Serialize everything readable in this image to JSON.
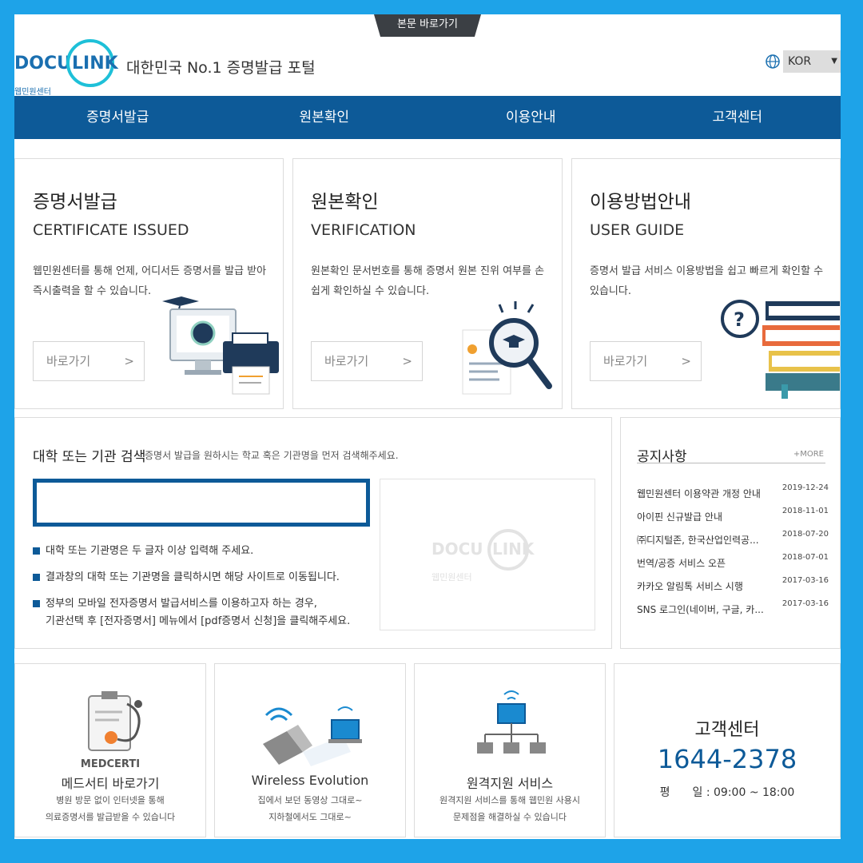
{
  "skip_link": "본문 바로가기",
  "header": {
    "logo_sub": "웹민원센터",
    "tagline": "대한민국 No.1 증명발급 포털",
    "language": "KOR"
  },
  "nav": [
    "증명서발급",
    "원본확인",
    "이용안내",
    "고객센터"
  ],
  "cards": [
    {
      "title": "증명서발급",
      "subtitle": "CERTIFICATE ISSUED",
      "desc": "웹민원센터를 통해 언제, 어디서든 증명서를 발급 받아 즉시출력을 할 수 있습니다.",
      "button": "바로가기",
      "arrow": ">"
    },
    {
      "title": "원본확인",
      "subtitle": "VERIFICATION",
      "desc": "원본확인 문서번호를 통해 증명서 원본 진위 여부를 손쉽게 확인하실 수 있습니다.",
      "button": "바로가기",
      "arrow": ">"
    },
    {
      "title": "이용방법안내",
      "subtitle": "USER GUIDE",
      "desc": "증명서 발급 서비스 이용방법을 쉽고 빠르게 확인할 수 있습니다.",
      "button": "바로가기",
      "arrow": ">"
    }
  ],
  "search": {
    "title": "대학 또는 기관 검색",
    "subtitle": "증명서 발급을 원하시는 학교 혹은 기관명을 먼저 검색해주세요.",
    "input_value": "",
    "bullets": [
      "대학 또는 기관명은 두 글자 이상 입력해 주세요.",
      "결과창의 대학 또는 기관명을 클릭하시면 해당 사이트로 이동됩니다.",
      "정부의 모바일 전자증명서 발급서비스를 이용하고자 하는 경우,\n기관선택 후 [전자증명서] 메뉴에서 [pdf증명서 신청]을 클릭해주세요."
    ],
    "watermark_sub": "웹민원센터"
  },
  "notice": {
    "title": "공지사항",
    "more": "+MORE",
    "items": [
      {
        "title": "웹민원센터 이용약관 개정 안내",
        "date": "2019-12-24"
      },
      {
        "title": "아이핀 신규발급 안내",
        "date": "2018-11-01"
      },
      {
        "title": "㈜디지털존, 한국산업인력공...",
        "date": "2018-07-20"
      },
      {
        "title": "번역/공증 서비스 오픈",
        "date": "2018-07-01"
      },
      {
        "title": "카카오 알림톡 서비스 시행",
        "date": "2017-03-16"
      },
      {
        "title": "SNS 로그인(네이버, 구글, 카...",
        "date": "2017-03-16"
      }
    ]
  },
  "bottom": [
    {
      "brand": "MEDCERTI",
      "title": "메드서티 바로가기",
      "lines": [
        "병원 방문 없이 인터넷을 통해",
        "의료증명서를 발급받을 수 있습니다"
      ]
    },
    {
      "title": "Wireless Evolution",
      "lines": [
        "집에서 보던 동영상 그대로~",
        "지하철에서도 그대로~"
      ]
    },
    {
      "title": "원격지원 서비스",
      "lines": [
        "원격지원 서비스를 통해 웹민원 사용시",
        "문제점을 해결하실 수 있습니다"
      ]
    }
  ],
  "customer_center": {
    "title": "고객센터",
    "phone": "1644-2378",
    "hours": "평　　일 : 09:00 ~ 18:00"
  },
  "colors": {
    "frame": "#1ea3e8",
    "nav": "#0d5a98",
    "accent": "#0d5a98"
  }
}
